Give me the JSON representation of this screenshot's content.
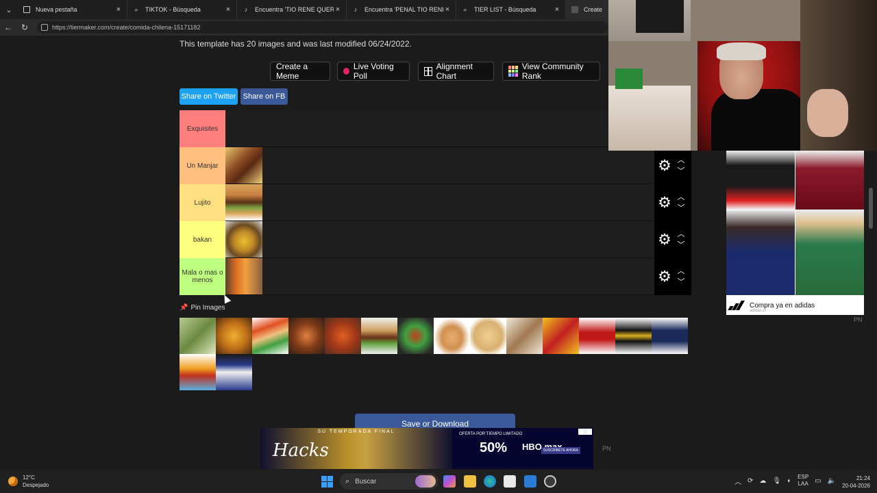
{
  "browser": {
    "tabs": [
      {
        "label": "Nueva pestaña",
        "icon": "new-tab-icon"
      },
      {
        "label": "TIKTOK - Búsqueda",
        "icon": "search-icon"
      },
      {
        "label": "Encuentra 'TIO RENE QUERI TO FU",
        "icon": "tiktok-icon"
      },
      {
        "label": "Encuentra 'PENAL TIO RENE' en Ti",
        "icon": "tiktok-icon"
      },
      {
        "label": "TIER LIST - Búsqueda",
        "icon": "search-icon"
      },
      {
        "label": "Create a Co",
        "icon": "tiermaker-icon"
      }
    ],
    "url": "https://tiermaker.com/create/comida-chilena-15171182"
  },
  "page": {
    "info_text": "This template has 20 images and was last modified 06/24/2022.",
    "buttons": {
      "create_meme": "Create a Meme",
      "live_poll": "Live Voting Poll",
      "alignment": "Alignment Chart",
      "community": "View Community Rank"
    },
    "share": {
      "twitter": "Share on Twitter",
      "fb": "Share on FB"
    },
    "tiers": [
      {
        "label": "Exquisites",
        "color": "#ff7f7f",
        "item_count": 0
      },
      {
        "label": "Un Manjar",
        "color": "#ffbf7f",
        "item_count": 1
      },
      {
        "label": "Lujito",
        "color": "#ffdf7f",
        "item_count": 1
      },
      {
        "label": "bakan",
        "color": "#ffff7f",
        "item_count": 1
      },
      {
        "label": "Mala o mas o menos",
        "color": "#bfff7f",
        "item_count": 1
      }
    ],
    "pin_images_label": "Pin Images",
    "pool_count": 16,
    "save_button": "Save or Download"
  },
  "ads": {
    "side_caption": "Compra ya en adidas",
    "side_sub": "adidas.cl",
    "pn_label": "PN",
    "bottom_pn": "PN",
    "bottom_left_title": "Hacks",
    "bottom_left_top": "SU TEMPORADA FINAL",
    "bottom_right_offer": "OFERTA POR TIEMPO LIMITADO",
    "bottom_right_pct": "50%",
    "bottom_right_brand": "HBO max",
    "bottom_right_cta": "SUSCRÍBETE AHORA"
  },
  "taskbar": {
    "temp": "12°C",
    "weather": "Despejado",
    "search": "Buscar",
    "lang_top": "ESP",
    "lang_bottom": "LAA",
    "time": "21:24",
    "date": "20-04-2026"
  }
}
